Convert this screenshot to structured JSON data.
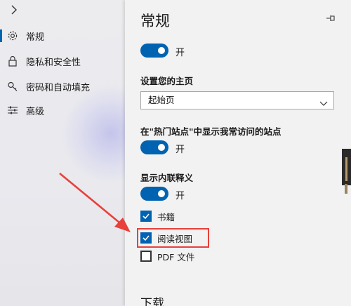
{
  "nav": {
    "items": [
      {
        "label": "常规",
        "icon": "gear-icon",
        "selected": true
      },
      {
        "label": "隐私和安全性",
        "icon": "lock-icon",
        "selected": false
      },
      {
        "label": "密码和自动填充",
        "icon": "key-icon",
        "selected": false
      },
      {
        "label": "高级",
        "icon": "sliders-icon",
        "selected": false
      }
    ]
  },
  "pane": {
    "title": "常规",
    "toggle1_label": "开",
    "homepage_label": "设置您的主页",
    "homepage_value": "起始页",
    "topsites_label": "在\"热门站点\"中显示我常访问的站点",
    "toggle2_label": "开",
    "inline_def_label": "显示内联释义",
    "toggle3_label": "开",
    "checkboxes": [
      {
        "label": "书籍",
        "checked": true
      },
      {
        "label": "阅读视图",
        "checked": true
      },
      {
        "label": "PDF 文件",
        "checked": false
      }
    ],
    "download_title": "下载"
  },
  "colors": {
    "accent": "#0063b1",
    "highlight": "#e8403a"
  }
}
